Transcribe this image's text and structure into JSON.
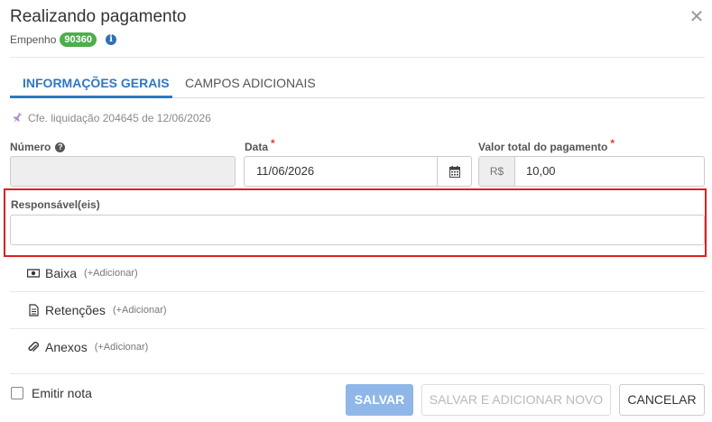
{
  "header": {
    "title": "Realizando pagamento",
    "subtitle_label": "Empenho",
    "empenho_badge": "90360",
    "close_icon": "close-icon",
    "info_icon": "info-circle-icon"
  },
  "tabs": [
    {
      "label": "INFORMAÇÕES GERAIS",
      "active": true
    },
    {
      "label": "CAMPOS ADICIONAIS",
      "active": false
    }
  ],
  "reference": {
    "icon": "pin-icon",
    "text": "Cfe. liquidação 204645 de 12/06/2026"
  },
  "form": {
    "numero": {
      "label": "Número",
      "value": "",
      "help_icon": "question-circle-icon"
    },
    "data": {
      "label": "Data",
      "required_mark": "*",
      "value": "11/06/2026",
      "icon": "calendar-icon"
    },
    "valor": {
      "label": "Valor total do pagamento",
      "required_mark": "*",
      "prefix": "R$",
      "value": "10,00"
    },
    "responsaveis": {
      "label": "Responsável(eis)",
      "value": ""
    }
  },
  "sections": [
    {
      "label": "Baixa",
      "add": "(+Adicionar)",
      "icon": "money-icon"
    },
    {
      "label": "Retenções",
      "add": "(+Adicionar)",
      "icon": "document-icon"
    },
    {
      "label": "Anexos",
      "add": "(+Adicionar)",
      "icon": "paperclip-icon"
    }
  ],
  "footer": {
    "emitir_nota_label": "Emitir nota",
    "emitir_nota_checked": false,
    "save_label": "SALVAR",
    "save_new_label": "SALVAR E ADICIONAR NOVO",
    "cancel_label": "CANCELAR"
  },
  "colors": {
    "accent": "#2f78c4",
    "badge": "#4cae4c",
    "highlight": "#e01e1e",
    "required": "#e23b3b"
  }
}
